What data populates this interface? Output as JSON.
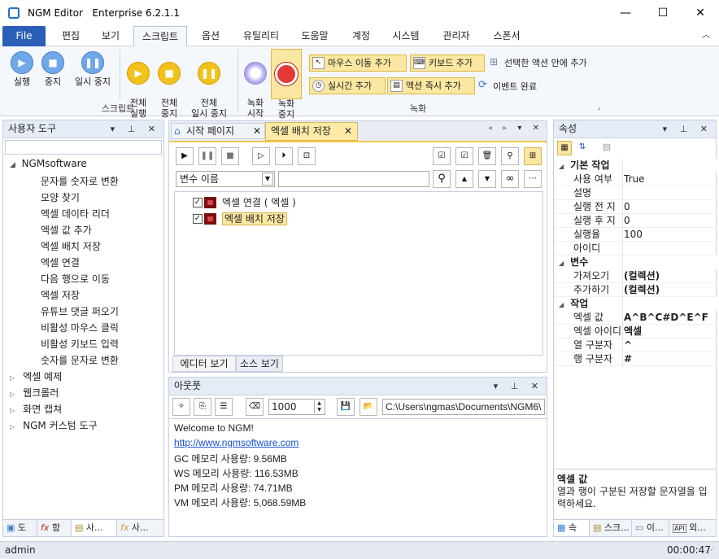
{
  "app": {
    "title": "NGM Editor",
    "edition": "Enterprise 6.2.1.1"
  },
  "window_controls": {
    "minimize": "—",
    "maximize": "☐",
    "close": "✕"
  },
  "ribbon_tabs": [
    "File",
    "편집",
    "보기",
    "스크립트",
    "옵션",
    "유틸리티",
    "도움말",
    "계정",
    "시스템",
    "관리자",
    "스폰서"
  ],
  "ribbon": {
    "script_group": {
      "label": "스크립트",
      "buttons": [
        "실행",
        "중지",
        "일시 중지",
        "전체\n실행",
        "전체\n중지",
        "전체\n일시 중지"
      ]
    },
    "record_group": {
      "label": "녹화",
      "record_start": "녹화\n시작",
      "record_stop": "녹화\n중지",
      "mouse_move": "마우스 이동 추가",
      "keyboard": "키보드 추가",
      "in_selected": "선택한 액션 안에 추가",
      "realtime": "실시간 추가",
      "action_now": "액션 즉시 추가",
      "event_done": "이벤트 완료"
    }
  },
  "left_panel": {
    "title": "사용자 도구",
    "root": "NGMsoftware",
    "items": [
      "문자를 숫자로 변환",
      "모양 찾기",
      "엑셀 데이타 리더",
      "엑셀 값 추가",
      "엑셀 배치 저장",
      "엑셀 연결",
      "다음 행으로 이동",
      "엑셀 저장",
      "유튜브 댓글 퍼오기",
      "비활성 마우스 클릭",
      "비활성 키보드 입력",
      "숫자를 문자로 변환"
    ],
    "collapsed": [
      "엑셀 예제",
      "웹크롤러",
      "화면 캡쳐",
      "NGM 커스텀 도구"
    ],
    "bottom_tabs": [
      "도",
      "함",
      "사...",
      "사..."
    ]
  },
  "doc_tabs": [
    "시작 페이지",
    "엑셀 배치 저장"
  ],
  "editor": {
    "variable_dropdown": "변수 이름",
    "nodes": [
      {
        "label": "엑셀 연결 ( 엑셀 )",
        "checked": true
      },
      {
        "label": "엑셀 배치 저장",
        "checked": true,
        "selected": true
      }
    ],
    "view_tabs": [
      "에디터 보기",
      "소스 보기"
    ]
  },
  "output": {
    "title": "아웃풋",
    "count": "1000",
    "path": "C:\\Users\\ngmas\\Documents\\NGM6\\",
    "lines": [
      "Welcome to NGM!",
      "http://www.ngmsoftware.com",
      "GC 메모리 사용량: 9.56MB",
      "WS 메모리 사용량: 116.53MB",
      "PM 메모리 사용량: 74.71MB",
      "VM 메모리 사용량: 5,068.59MB"
    ]
  },
  "properties": {
    "title": "속성",
    "categories": [
      {
        "name": "기본 작업",
        "rows": [
          [
            "사용 여부",
            "True"
          ],
          [
            "설명",
            ""
          ],
          [
            "실행 전 지",
            "0"
          ],
          [
            "실행 후 지",
            "0"
          ],
          [
            "실행율",
            "100"
          ],
          [
            "아이디",
            ""
          ]
        ]
      },
      {
        "name": "변수",
        "rows": [
          [
            "가져오기",
            "(컬렉션)"
          ],
          [
            "추가하기",
            "(컬렉션)"
          ]
        ]
      },
      {
        "name": "작업",
        "rows": [
          [
            "엑셀 값",
            "A^B^C#D^E^F"
          ],
          [
            "엑셀 아이디",
            "엑셀"
          ],
          [
            "열 구분자",
            "^"
          ],
          [
            "행 구분자",
            "#"
          ]
        ]
      }
    ],
    "desc_title": "엑셀 값",
    "desc_text": "열과 행이 구분된 저장할 문자열을 입력하세요.",
    "bottom_tabs": [
      "속",
      "스크...",
      "이...",
      "외..."
    ]
  },
  "status": {
    "user": "admin",
    "time": "00:00:47"
  },
  "colors": {
    "accent": "#2b5fb7",
    "highlight": "#fbe7a1",
    "record": "#e53935"
  }
}
